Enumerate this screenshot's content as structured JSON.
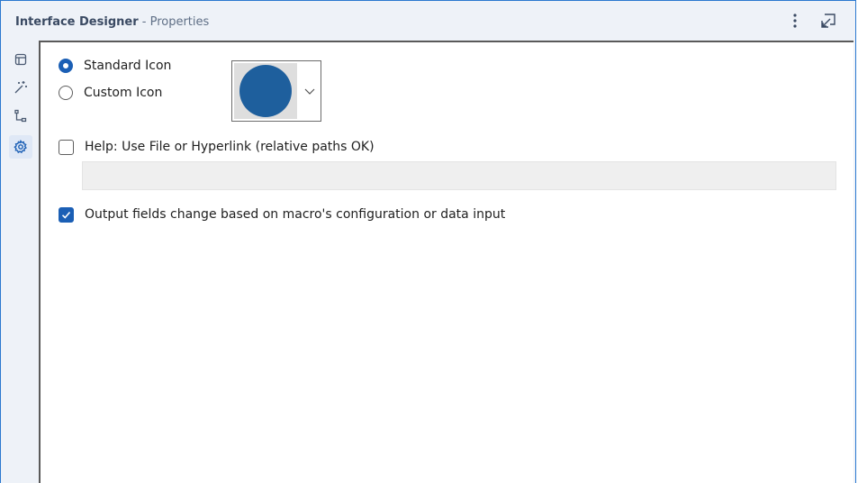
{
  "window": {
    "title_app": "Interface Designer",
    "title_sep": " - ",
    "title_sub": "Properties",
    "menu_icon": "kebab-menu-icon",
    "undock_icon": "undock-icon"
  },
  "sidebar": {
    "items": [
      {
        "name": "layout",
        "icon": "layout-icon",
        "active": false
      },
      {
        "name": "wizard",
        "icon": "magic-wand-icon",
        "active": false
      },
      {
        "name": "tree",
        "icon": "tree-icon",
        "active": false
      },
      {
        "name": "properties",
        "icon": "gear-icon",
        "active": true
      }
    ]
  },
  "properties": {
    "icon_options": {
      "standard_label": "Standard Icon",
      "custom_label": "Custom Icon",
      "selected": "standard"
    },
    "icon_preview_color": "#1e5f9d",
    "help": {
      "label": "Help: Use File or Hyperlink (relative paths OK)",
      "checked": false,
      "value": ""
    },
    "output_fields": {
      "label": "Output fields change based on macro's configuration or data input",
      "checked": true
    }
  },
  "colors": {
    "accent": "#1b5fb5",
    "border": "#2b79d0",
    "panel_bg": "#eef2f8"
  }
}
